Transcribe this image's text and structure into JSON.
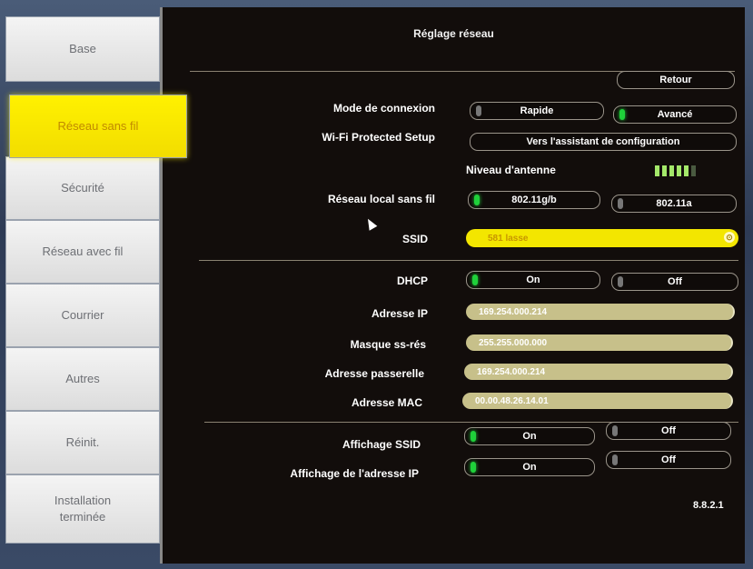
{
  "panel": {
    "title": "Réglage réseau",
    "back_label": "Retour",
    "version": "8.8.2.1"
  },
  "tabs": [
    {
      "label": "Base",
      "active": false
    },
    {
      "label": "Réseau sans fil",
      "active": true
    },
    {
      "label": "Sécurité",
      "active": false
    },
    {
      "label": "Réseau avec fil",
      "active": false
    },
    {
      "label": "Courrier",
      "active": false
    },
    {
      "label": "Autres",
      "active": false
    },
    {
      "label": "Réinit.",
      "active": false
    },
    {
      "label": "Installation\nterminée",
      "active": false
    }
  ],
  "connection_mode": {
    "label": "Mode de connexion",
    "options": [
      "Rapide",
      "Avancé"
    ],
    "selected": "Avancé"
  },
  "wps": {
    "label": "Wi-Fi Protected Setup",
    "button": "Vers l'assistant de configuration"
  },
  "antenna": {
    "label": "Niveau d'antenne",
    "level": 5,
    "max": 6
  },
  "wireless_lan": {
    "label": "Réseau local sans fil",
    "options": [
      "802.11g/b",
      "802.11a"
    ],
    "selected": "802.11g/b"
  },
  "ssid": {
    "label": "SSID",
    "value": "581 lasse"
  },
  "dhcp": {
    "label": "DHCP",
    "options": [
      "On",
      "Off"
    ],
    "selected": "On"
  },
  "ip_address": {
    "label": "Adresse IP",
    "value": "169.254.000.214"
  },
  "subnet_mask": {
    "label": "Masque ss-rés",
    "value": "255.255.000.000"
  },
  "gateway": {
    "label": "Adresse passerelle",
    "value": "169.254.000.214"
  },
  "mac": {
    "label": "Adresse MAC",
    "value": "00.00.48.26.14.01"
  },
  "ssid_display": {
    "label": "Affichage SSID",
    "options": [
      "On",
      "Off"
    ],
    "selected": "On"
  },
  "ip_display": {
    "label": "Affichage de l'adresse IP",
    "options": [
      "On",
      "Off"
    ],
    "selected": "On"
  },
  "colors": {
    "panel_bg": "#120d0b",
    "active_tab": "#fff100",
    "field": "#c7c08a",
    "selected_indicator": "#1fd13a"
  }
}
